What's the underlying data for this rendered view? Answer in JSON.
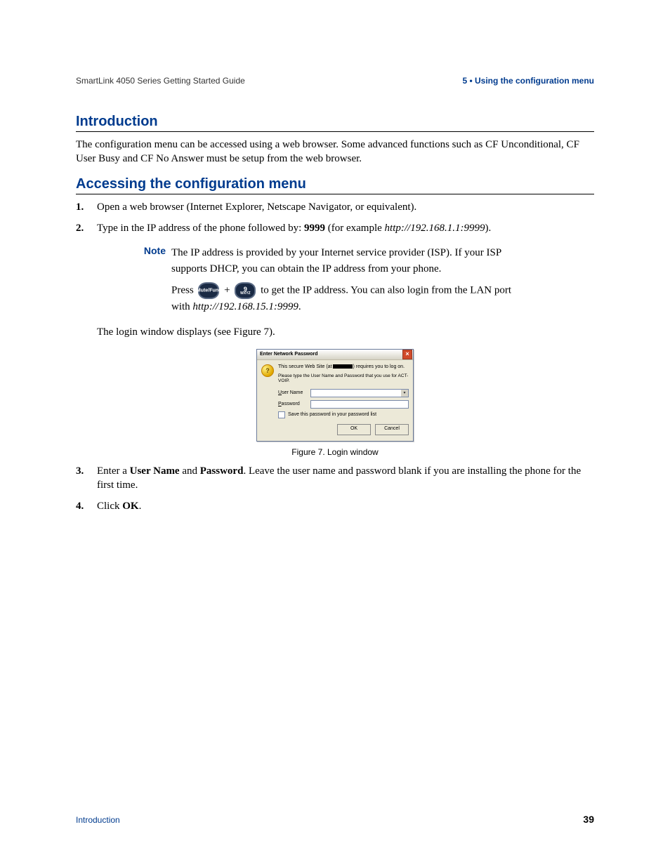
{
  "header": {
    "left": "SmartLink 4050 Series Getting Started Guide",
    "right": "5 • Using the configuration menu"
  },
  "sections": {
    "intro": {
      "title": "Introduction",
      "body": "The configuration menu can be accessed using a web browser. Some advanced functions such as CF Unconditional, CF User Busy and CF No Answer must be setup from the web browser."
    },
    "access": {
      "title": "Accessing the configuration menu",
      "step1": {
        "num": "1.",
        "text": "Open a web browser (Internet Explorer, Netscape Navigator, or equivalent)."
      },
      "step2": {
        "num": "2.",
        "pre": "Type in the IP address of the phone followed by: ",
        "bold": "9999",
        "mid": " (for example ",
        "url": "http://192.168.1.1:9999",
        "post": ")."
      },
      "note": {
        "label": "Note",
        "line1": "The IP address is provided by your Internet service provider (ISP). If your ISP supports DHCP, you can obtain the IP address from your phone.",
        "press_word": "Press ",
        "key1": "Mute/Func",
        "plus": "  +  ",
        "key2_top": "9",
        "key2_bot": "WXYZ",
        "after_keys": " to get the IP address. You can also login from the LAN port with ",
        "lan_url": "http://192.168.15.1:9999",
        "period": "."
      },
      "after_note": "The login window displays (see Figure 7).",
      "figure": {
        "title": "Enter Network Password",
        "site_pre": "This secure Web Site (at ",
        "site_post": ") requires you to log on.",
        "instr": "Please type the User Name and Password that you use for ACT-VOIP.",
        "username_label_u": "U",
        "username_label_rest": "ser Name",
        "password_label_u": "P",
        "password_label_rest": "assword",
        "save_u": "S",
        "save_rest": "ave this password in your password list",
        "ok": "OK",
        "cancel": "Cancel",
        "caption": "Figure 7. Login window"
      },
      "step3": {
        "num": "3.",
        "pre": "Enter a ",
        "b1": "User Name",
        "mid": " and ",
        "b2": "Password",
        "post": ". Leave the user name and password blank if you are installing the phone for the first time."
      },
      "step4": {
        "num": "4.",
        "pre": "Click ",
        "b1": "OK",
        "post": "."
      }
    }
  },
  "footer": {
    "left": "Introduction",
    "pagenum": "39"
  }
}
